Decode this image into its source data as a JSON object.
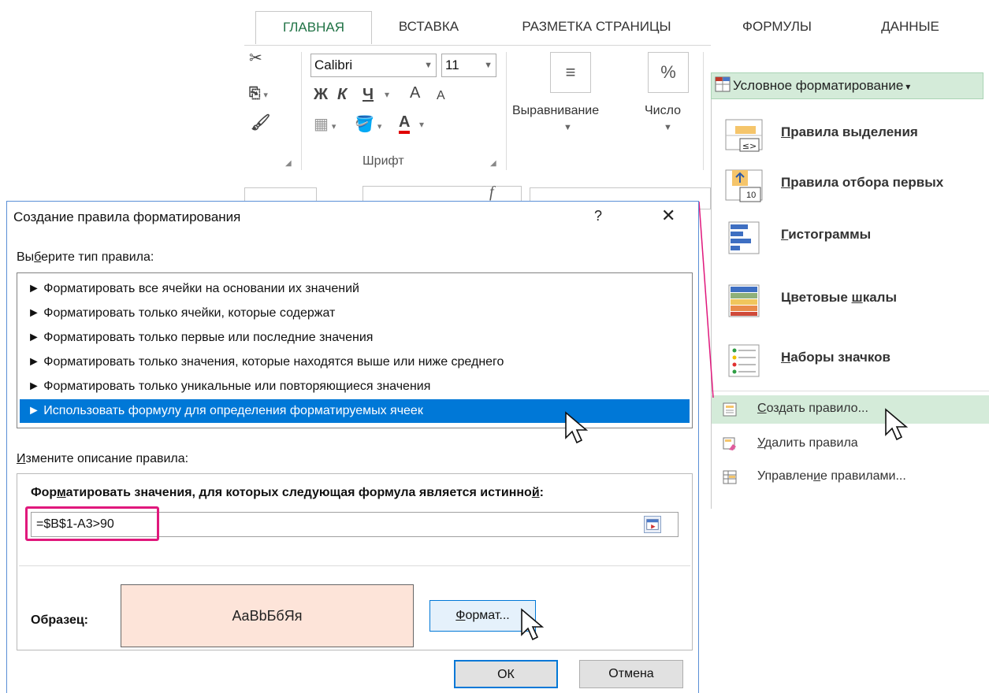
{
  "ribbon": {
    "tabs": [
      "ГЛАВНАЯ",
      "ВСТАВКА",
      "РАЗМЕТКА СТРАНИЦЫ",
      "ФОРМУЛЫ",
      "ДАННЫЕ"
    ],
    "font_name": "Calibri",
    "font_size": "11",
    "bold": "Ж",
    "italic": "К",
    "underline": "Ч",
    "grow_font": "A",
    "shrink_font": "A",
    "font_color_letter": "A",
    "font_group_label": "Шрифт",
    "alignment_label": "Выравнивание",
    "number_label": "Число",
    "percent_symbol": "%",
    "formula_fx": "f",
    "accent_color": "#217346"
  },
  "cf_menu": {
    "button_label": "Условное форматирование",
    "highlight_rules": {
      "prefix": "",
      "hotkey": "П",
      "rest": "равила выделения"
    },
    "top_rules": {
      "prefix": "",
      "hotkey": "П",
      "rest": "равила отбора первых"
    },
    "data_bars": {
      "prefix": "",
      "hotkey": "Г",
      "rest": "истограммы"
    },
    "color_scales": {
      "prefix": "Цветовые ",
      "hotkey": "ш",
      "rest": "калы"
    },
    "icon_sets": {
      "prefix": "",
      "hotkey": "Н",
      "rest": "аборы значков"
    },
    "new_rule": {
      "prefix": "",
      "hotkey": "С",
      "rest": "оздать правило..."
    },
    "clear_rules": {
      "prefix": "",
      "hotkey": "У",
      "rest": "далить правила"
    },
    "manage_rules": {
      "prefix": "Управлен",
      "hotkey": "и",
      "rest": "е правилами..."
    },
    "top_rules_number": "10",
    "highlight_color": "#d4ebd9"
  },
  "dialog": {
    "title": "Создание правила форматирования",
    "help": "?",
    "close": "✕",
    "select_type": {
      "prefix": "Вы",
      "hotkey": "б",
      "rest": "ерите тип правила:"
    },
    "rule_types": [
      "► Форматировать все ячейки на основании их значений",
      "► Форматировать только ячейки, которые содержат",
      "► Форматировать только первые или последние значения",
      "► Форматировать только значения, которые находятся выше или ниже среднего",
      "► Форматировать только уникальные или повторяющиеся значения",
      "► Использовать формулу для определения форматируемых ячеек"
    ],
    "edit_desc": {
      "prefix": "",
      "hotkey": "И",
      "rest": "змените описание правила:"
    },
    "formula_header": {
      "prefix": "Фор",
      "hotkey": "м",
      "rest1": "атировать значения, для которых следующая формула является истинно",
      "hotkey2": "й",
      "rest2": ":"
    },
    "formula_value": "=$B$1-A3>90",
    "preview_label": "Образец:",
    "preview_text": "AaBbБбЯя",
    "format_button": {
      "prefix": "",
      "hotkey": "Ф",
      "rest": "ормат..."
    },
    "ok": "ОК",
    "cancel": "Отмена",
    "selected_color": "#0078d7",
    "preview_bg": "#fde4d9",
    "highlight_box_color": "#e0187c"
  }
}
